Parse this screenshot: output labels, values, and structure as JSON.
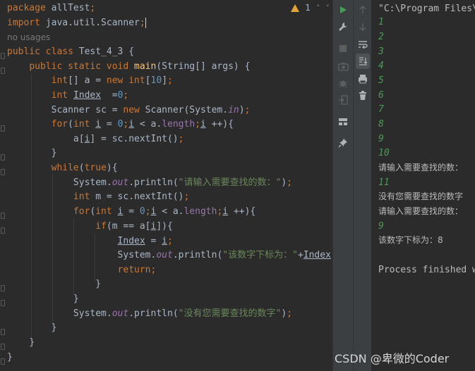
{
  "inspection": {
    "warning_count": "1",
    "up_arrow": "˄",
    "down_arrow": "˅"
  },
  "code": {
    "l0_kw": "package",
    "l0_rest": " allTest",
    "l0_semi": ";",
    "l1_kw": "import",
    "l1_rest": " java.util.Scanner",
    "l1_semi": ";",
    "l2_hint": "no usages",
    "l3_kw": "public class",
    "l3_rest": " Test_4_3 {",
    "l4_kw": "public static void",
    "l4_fn": " main",
    "l4_rest": "(String[] args) {",
    "l5_a": "int",
    "l5_b": "[] a = ",
    "l5_c": "new int",
    "l5_d": "[",
    "l5_e": "10",
    "l5_f": "]",
    "l5_g": ";",
    "l6_a": "int",
    "l6_var": "Index",
    "l6_b": "  =",
    "l6_num": "0",
    "l6_semi": ";",
    "l7_a": "Scanner sc = ",
    "l7_new": "new",
    "l7_b": " Scanner(System.",
    "l7_in": "in",
    "l7_c": ")",
    "l7_semi": ";",
    "l8_for": "for",
    "l8_b": "(",
    "l8_int": "int",
    "l8_i": "i",
    "l8_c": " = ",
    "l8_zero": "0",
    "l8_semi1": ";",
    "l8_i2": "i",
    "l8_d": " < a.",
    "l8_len": "length",
    "l8_semi2": ";",
    "l8_i3": "i",
    "l8_e": " ++){",
    "l9_a": "a[",
    "l9_i": "i",
    "l9_b": "] = sc.nextInt()",
    "l9_semi": ";",
    "l10": "}",
    "l11_while": "while",
    "l11_b": "(",
    "l11_true": "true",
    "l11_c": "){",
    "l12_a": "System.",
    "l12_out": "out",
    "l12_b": ".println(",
    "l12_str": "\"请输入需要查找的数：\"",
    "l12_c": ")",
    "l12_semi": ";",
    "l13_int": "int",
    "l13_b": " m = sc.nextInt()",
    "l13_semi": ";",
    "l14_for": "for",
    "l14_b": "(",
    "l14_int": "int",
    "l14_i": "i",
    "l14_c": " = ",
    "l14_zero": "0",
    "l14_semi1": ";",
    "l14_i2": "i",
    "l14_d": " < a.",
    "l14_len": "length",
    "l14_semi2": ";",
    "l14_i3": "i",
    "l14_e": " ++){",
    "l15_if": "if",
    "l15_b": "(m == a[",
    "l15_i": "i",
    "l15_c": "]){",
    "l16_var": "Index",
    "l16_b": " = ",
    "l16_i": "i",
    "l16_semi": ";",
    "l17_a": "System.",
    "l17_out": "out",
    "l17_b": ".println(",
    "l17_str": "\"该数字下标为：\"",
    "l17_c": "+",
    "l17_var": "Index",
    "l17_d": ")",
    "l17_semi": ";",
    "l18_ret": "return",
    "l18_semi": ";",
    "l19": "}",
    "l20": "}",
    "l21_a": "System.",
    "l21_out": "out",
    "l21_b": ".println(",
    "l21_str": "\"没有您需要查找的数字\"",
    "l21_c": ")",
    "l21_semi": ";",
    "l22": "}",
    "l23": "}",
    "l24": "}"
  },
  "run_toolbar": {
    "icons": [
      "run-icon",
      "wrench-icon",
      "stop-icon",
      "camera-icon",
      "debug-icon",
      "exit-icon",
      "layout-icon",
      "pin-icon"
    ]
  },
  "console_toolbar": {
    "icons": [
      "up-arrow-icon",
      "down-arrow-icon",
      "soft-wrap-icon",
      "scroll-to-end-icon",
      "print-icon",
      "trash-icon"
    ]
  },
  "console": {
    "cmd": "\"C:\\Program Files\\",
    "inputs": [
      "1",
      "2",
      "3",
      "4",
      "5",
      "6",
      "7",
      "8",
      "9",
      "10"
    ],
    "prompt1": "请输入需要查找的数：",
    "input11": "11",
    "not_found": "没有您需要查找的数字",
    "prompt2": "请输入需要查找的数：",
    "input9": "9",
    "result": "该数字下标为：8",
    "finished": "Process finished wi"
  },
  "watermark": "CSDN @卑微的Coder",
  "colors": {
    "editor_bg": "#2b2b2b",
    "keyword": "#cc7832",
    "method": "#ffc66d",
    "number": "#6897bb",
    "string": "#6a8759",
    "static_field": "#9876aa",
    "console_input": "#499c54",
    "warning": "#e2a53a"
  }
}
